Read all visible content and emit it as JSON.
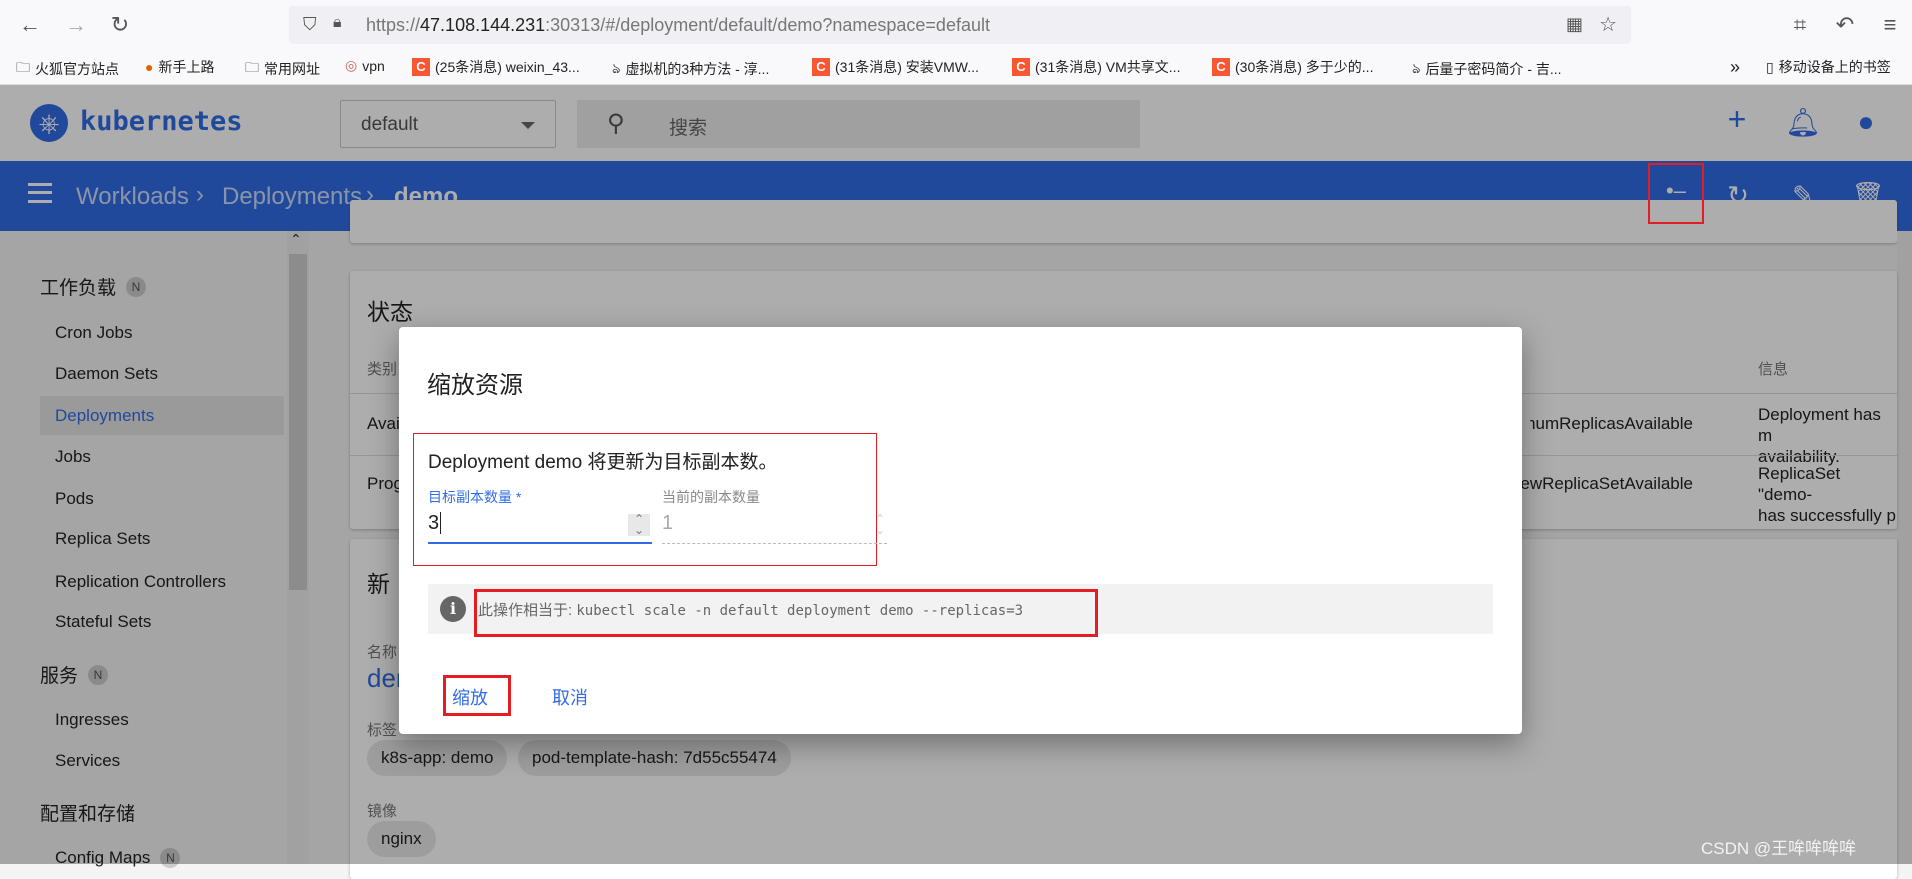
{
  "browser": {
    "url_prefix": "https://",
    "url_host": "47.108.144.231",
    "url_rest": ":30313/#/deployment/default/demo?namespace=default",
    "icons": [
      "back-icon",
      "forward-icon",
      "reload-icon",
      "shield-icon",
      "lock-icon",
      "qr-icon",
      "star-icon",
      "crop-icon",
      "undo-icon",
      "menu-icon"
    ],
    "bookmarks": [
      {
        "label": "火狐官方站点",
        "icon": "folder"
      },
      {
        "label": "新手上路",
        "icon": "firefox"
      },
      {
        "label": "常用网址",
        "icon": "folder"
      },
      {
        "label": "vpn",
        "icon": "vpn"
      },
      {
        "label": "(25条消息) weixin_43...",
        "icon": "csdn"
      },
      {
        "label": "虚拟机的3种方法 - 淳...",
        "icon": "bird"
      },
      {
        "label": "(31条消息) 安装VMW...",
        "icon": "csdn"
      },
      {
        "label": "(31条消息) VM共享文...",
        "icon": "csdn"
      },
      {
        "label": "(30条消息) 多于少的...",
        "icon": "csdn"
      },
      {
        "label": "后量子密码简介 - 吉...",
        "icon": "bird"
      }
    ],
    "more": "»",
    "mobile_bookmarks": "移动设备上的书签"
  },
  "header": {
    "logo_text": "kubernetes",
    "namespace": "default",
    "search_placeholder": "搜索",
    "brand_color": "#326ce5"
  },
  "toolbar": {
    "breadcrumbs": [
      "Workloads",
      "Deployments",
      "demo"
    ],
    "actions": [
      "scale-icon",
      "refresh-icon",
      "edit-icon",
      "delete-icon"
    ]
  },
  "sidebar": {
    "sections": [
      {
        "label": "工作负载",
        "badge": "N",
        "items": [
          "Cron Jobs",
          "Daemon Sets",
          "Deployments",
          "Jobs",
          "Pods",
          "Replica Sets",
          "Replication Controllers",
          "Stateful Sets"
        ]
      },
      {
        "label": "服务",
        "badge": "N",
        "items": [
          "Ingresses",
          "Services"
        ]
      },
      {
        "label": "配置和存储",
        "items": [
          "Config Maps"
        ],
        "config_badge": "N"
      }
    ],
    "selected": "Deployments"
  },
  "status_card": {
    "title": "状态",
    "col_type": "类别",
    "col_info": "信息",
    "rows": [
      {
        "type": "Available",
        "reason": "MinimumReplicasAvailable",
        "info1": "Deployment has m",
        "info2": "availability."
      },
      {
        "type": "Progressing",
        "reason": "NewReplicaSetAvailable",
        "info1": "ReplicaSet \"demo-",
        "info2": "has successfully p"
      }
    ]
  },
  "replicaset_card": {
    "title": "新",
    "name_label": "名称",
    "name_value": "der",
    "labels_label": "标签",
    "labels": [
      "k8s-app: demo",
      "pod-template-hash: 7d55c55474"
    ],
    "images_label": "镜像",
    "images": [
      "nginx"
    ]
  },
  "dialog": {
    "title": "缩放资源",
    "description": "Deployment demo 将更新为目标副本数。",
    "target_label": "目标副本数量 *",
    "target_value": "3",
    "current_label": "当前的副本数量",
    "current_value": "1",
    "info_prefix": "此操作相当于: ",
    "info_command": "kubectl scale -n default deployment demo --replicas=3",
    "scale_button": "缩放",
    "cancel_button": "取消",
    "accent_color": "#326ce5",
    "highlight_color": "#e31d24"
  },
  "watermark": "CSDN @王哞哞哞哞"
}
